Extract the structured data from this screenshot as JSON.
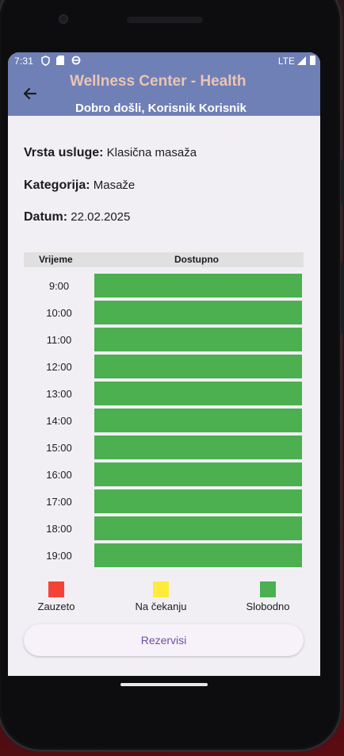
{
  "status_bar": {
    "time": "7:31",
    "network": "LTE"
  },
  "app_bar": {
    "title": "Wellness Center - Health",
    "subtitle": "Dobro došli, Korisnik Korisnik",
    "colors": {
      "background": "#6f80b6",
      "title": "#ecc4b3",
      "subtitle": "#ffffff"
    }
  },
  "details": {
    "service_label": "Vrsta usluge:",
    "service_value": "Klasična masaža",
    "category_label": "Kategorija:",
    "category_value": "Masaže",
    "date_label": "Datum:",
    "date_value": "22.02.2025"
  },
  "table": {
    "headers": {
      "time": "Vrijeme",
      "availability": "Dostupno"
    },
    "rows": [
      {
        "time": "9:00",
        "status": "free"
      },
      {
        "time": "10:00",
        "status": "free"
      },
      {
        "time": "11:00",
        "status": "free"
      },
      {
        "time": "12:00",
        "status": "free"
      },
      {
        "time": "13:00",
        "status": "free"
      },
      {
        "time": "14:00",
        "status": "free"
      },
      {
        "time": "15:00",
        "status": "free"
      },
      {
        "time": "16:00",
        "status": "free"
      },
      {
        "time": "17:00",
        "status": "free"
      },
      {
        "time": "18:00",
        "status": "free"
      },
      {
        "time": "19:00",
        "status": "free"
      }
    ]
  },
  "legend": [
    {
      "label": "Zauzeto",
      "color": "#f44336"
    },
    {
      "label": "Na čekanju",
      "color": "#ffeb3b"
    },
    {
      "label": "Slobodno",
      "color": "#4caf50"
    }
  ],
  "status_colors": {
    "free": "#4caf50",
    "busy": "#f44336",
    "pending": "#ffeb3b"
  },
  "reserve_button": {
    "label": "Rezervisi"
  },
  "icons": {
    "back": "arrow-left-icon"
  }
}
